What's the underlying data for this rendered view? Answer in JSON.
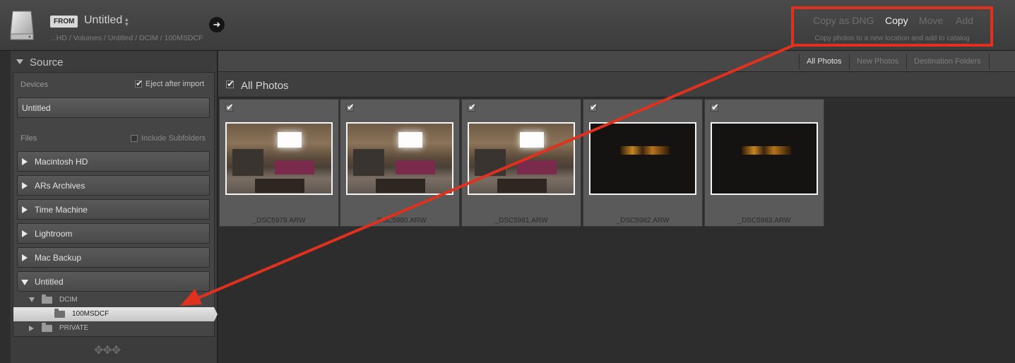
{
  "header": {
    "from_label": "FROM",
    "source_name": "Untitled",
    "source_caret": "⌃⌄",
    "path": "...HD / Volumes / Untitled / DCIM / 100MSDCF",
    "go_icon": "arrow-right-icon",
    "modes": [
      "Copy as DNG",
      "Copy",
      "Move",
      "Add"
    ],
    "active_mode": "Copy",
    "mode_hint": "Copy photos to a new location and add to catalog",
    "annotation_color": "#e0311e"
  },
  "source_panel": {
    "title": "Source",
    "devices_label": "Devices",
    "eject_label": "Eject after import",
    "eject_checked": true,
    "device_name": "Untitled",
    "files_label": "Files",
    "subfolders_label": "Include Subfolders",
    "subfolders_checked": false,
    "volumes": [
      "Macintosh HD",
      "ARs Archives",
      "Time Machine",
      "Lightroom",
      "Mac Backup",
      "Untitled"
    ],
    "folders": [
      "DCIM",
      "100MSDCF",
      "PRIVATE"
    ],
    "selected_folder": "100MSDCF"
  },
  "grid": {
    "tabs": [
      "All Photos",
      "New Photos",
      "Destination Folders"
    ],
    "active_tab": "All Photos",
    "section_title": "All Photos",
    "photos": [
      {
        "filename": "_DSC5979.ARW",
        "checked": true
      },
      {
        "filename": "_DSC5980.ARW",
        "checked": true
      },
      {
        "filename": "_DSC5981.ARW",
        "checked": true
      },
      {
        "filename": "_DSC5982.ARW",
        "checked": true
      },
      {
        "filename": "_DSC5983.ARW",
        "checked": true
      }
    ]
  },
  "ornament": "✥✥✥"
}
